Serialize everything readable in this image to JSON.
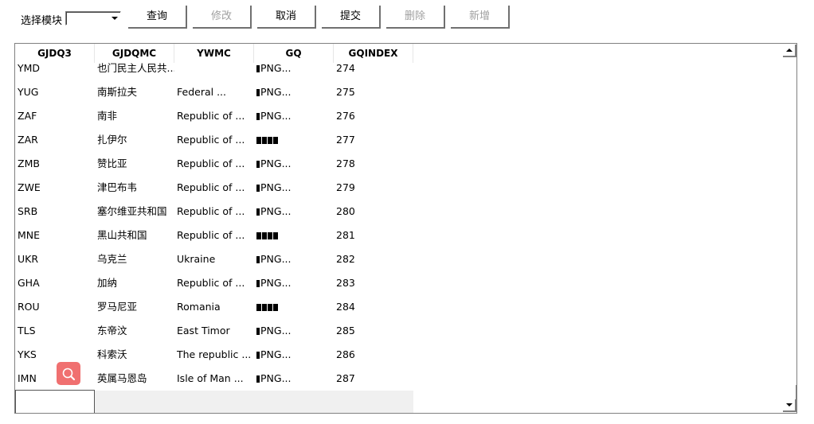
{
  "toolbar": {
    "module_label": "选择模块",
    "module_select_value": "",
    "buttons": [
      {
        "label": "查询",
        "enabled": true
      },
      {
        "label": "修改",
        "enabled": false
      },
      {
        "label": "取消",
        "enabled": true
      },
      {
        "label": "提交",
        "enabled": true
      },
      {
        "label": "删除",
        "enabled": false
      },
      {
        "label": "新增",
        "enabled": false
      }
    ]
  },
  "grid": {
    "columns": [
      "GJDQ3",
      "GJDQMC",
      "YWMC",
      "GQ",
      "GQINDEX"
    ],
    "rows": [
      {
        "GJDQ3": "YMD",
        "GJDQMC": "也门民主人民共...",
        "YWMC": "",
        "GQ": "PNG...",
        "GQ_type": "png",
        "GQINDEX": "274"
      },
      {
        "GJDQ3": "YUG",
        "GJDQMC": "南斯拉夫",
        "YWMC": "Federal ...",
        "GQ": "PNG...",
        "GQ_type": "png",
        "GQINDEX": "275"
      },
      {
        "GJDQ3": "ZAF",
        "GJDQMC": "南非",
        "YWMC": "Republic of ...",
        "GQ": "PNG...",
        "GQ_type": "png",
        "GQINDEX": "276"
      },
      {
        "GJDQ3": "ZAR",
        "GJDQMC": "扎伊尔",
        "YWMC": "Republic of ...",
        "GQ": "",
        "GQ_type": "blocks",
        "GQINDEX": "277"
      },
      {
        "GJDQ3": "ZMB",
        "GJDQMC": "赞比亚",
        "YWMC": "Republic of ...",
        "GQ": "PNG...",
        "GQ_type": "png",
        "GQINDEX": "278"
      },
      {
        "GJDQ3": "ZWE",
        "GJDQMC": "津巴布韦",
        "YWMC": "Republic of ...",
        "GQ": "PNG...",
        "GQ_type": "png",
        "GQINDEX": "279"
      },
      {
        "GJDQ3": "SRB",
        "GJDQMC": "塞尔维亚共和国",
        "YWMC": "Republic of ...",
        "GQ": "PNG...",
        "GQ_type": "png",
        "GQINDEX": "280"
      },
      {
        "GJDQ3": "MNE",
        "GJDQMC": "黑山共和国",
        "YWMC": "Republic of ...",
        "GQ": "",
        "GQ_type": "blocks",
        "GQINDEX": "281"
      },
      {
        "GJDQ3": "UKR",
        "GJDQMC": "乌克兰",
        "YWMC": "Ukraine",
        "GQ": "PNG...",
        "GQ_type": "png",
        "GQINDEX": "282"
      },
      {
        "GJDQ3": "GHA",
        "GJDQMC": "加纳",
        "YWMC": "Republic of ...",
        "GQ": "PNG...",
        "GQ_type": "png",
        "GQINDEX": "283"
      },
      {
        "GJDQ3": "ROU",
        "GJDQMC": "罗马尼亚",
        "YWMC": "Romania",
        "GQ": "",
        "GQ_type": "blocks",
        "GQINDEX": "284"
      },
      {
        "GJDQ3": "TLS",
        "GJDQMC": "东帝汶",
        "YWMC": "East Timor",
        "GQ": "PNG...",
        "GQ_type": "png",
        "GQINDEX": "285"
      },
      {
        "GJDQ3": "YKS",
        "GJDQMC": "科索沃",
        "YWMC": "The  republic ...",
        "GQ": "PNG...",
        "GQ_type": "png",
        "GQINDEX": "286"
      },
      {
        "GJDQ3": "IMN",
        "GJDQMC": "英属马恩岛",
        "YWMC": "Isle of Man ...",
        "GQ": "PNG...",
        "GQ_type": "png",
        "GQINDEX": "287"
      }
    ],
    "footer_input_value": ""
  },
  "icons": {
    "search_fab": "search-icon",
    "scroll_up": "arrow-up-icon",
    "scroll_down": "arrow-down-icon",
    "dropdown": "chevron-down-icon"
  },
  "colors": {
    "search_fab_bg": "#f07070",
    "disabled_text": "#a0a0a0"
  }
}
